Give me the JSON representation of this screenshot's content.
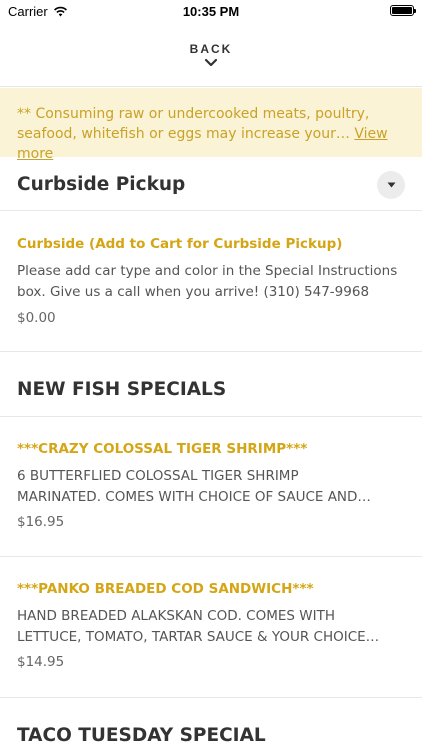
{
  "status_bar": {
    "carrier": "Carrier",
    "time": "10:35 PM",
    "icons": [
      "wifi-icon",
      "battery-icon"
    ]
  },
  "nav": {
    "back_label": "BACK",
    "back_icon": "chevron-down-icon"
  },
  "notice": {
    "text": "** Consuming raw or undercooked meats, poultry, seafood, whitefish or eggs may increase your…",
    "link": "View more",
    "color": "#c9a227",
    "background": "#fbf3d5"
  },
  "sections": [
    {
      "title": "Curbside Pickup",
      "dropdown_icon": "caret-down-icon",
      "items": [
        {
          "title": "Curbside (Add to Cart for Curbside Pickup)",
          "description": "Please add car type and color in the Special Instructions box. Give us a call when you arrive! (310) 547-9968",
          "price": "$0.00"
        }
      ]
    },
    {
      "title": "NEW FISH SPECIALS",
      "items": [
        {
          "title": "***CRAZY COLOSSAL TIGER SHRIMP***",
          "description_line1": "6 BUTTERFLIED COLOSSAL TIGER SHRIMP",
          "description_line2": "MARINATED. COMES WITH CHOICE OF SAUCE AND…",
          "price": "$16.95"
        },
        {
          "title": "***PANKO BREADED COD SANDWICH***",
          "description_line1": "HAND BREADED ALAKSKAN COD. COMES WITH",
          "description_line2": "LETTUCE, TOMATO, TARTAR SAUCE & YOUR CHOICE…",
          "price": "$14.95"
        }
      ]
    },
    {
      "title": "TACO TUESDAY SPECIAL"
    }
  ],
  "colors": {
    "accent": "#d4a514",
    "text": "#333333"
  }
}
